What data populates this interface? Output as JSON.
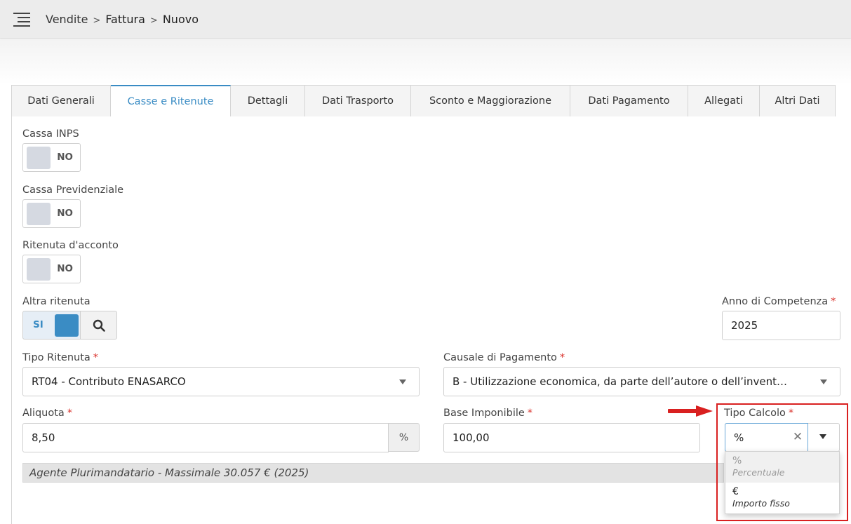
{
  "breadcrumb": [
    "Vendite",
    "Fattura",
    "Nuovo"
  ],
  "tabs": [
    "Dati Generali",
    "Casse e Ritenute",
    "Dettagli",
    "Dati Trasporto",
    "Sconto e Maggiorazione",
    "Dati Pagamento",
    "Allegati",
    "Altri Dati"
  ],
  "active_tab": "Casse e Ritenute",
  "colors": {
    "accent": "#3a8cc4",
    "required": "#d9302a",
    "highlight": "#d92020"
  },
  "form": {
    "cassa_inps": {
      "label": "Cassa INPS",
      "toggle": "NO"
    },
    "cassa_previdenziale": {
      "label": "Cassa Previdenziale",
      "toggle": "NO"
    },
    "ritenuta_acconto": {
      "label": "Ritenuta d'acconto",
      "toggle": "NO"
    },
    "altra_ritenuta": {
      "label": "Altra ritenuta",
      "toggle": "SI"
    },
    "anno_competenza": {
      "label": "Anno di Competenza",
      "required": "*",
      "value": "2025"
    },
    "tipo_ritenuta": {
      "label": "Tipo Ritenuta",
      "required": "*",
      "value": "RT04 - Contributo ENASARCO"
    },
    "causale_pagamento": {
      "label": "Causale di Pagamento",
      "required": "*",
      "value": "B - Utilizzazione economica, da parte dell’autore o dell’invent…"
    },
    "aliquota": {
      "label": "Aliquota",
      "required": "*",
      "value": "8,50",
      "addon": "%"
    },
    "base_imponibile": {
      "label": "Base Imponibile",
      "required": "*",
      "value": "100,00"
    },
    "tipo_calcolo": {
      "label": "Tipo Calcolo",
      "required": "*",
      "value": "%",
      "clear": "✕",
      "options": [
        {
          "symbol": "%",
          "description": "Percentuale"
        },
        {
          "symbol": "€",
          "description": "Importo fisso"
        }
      ]
    },
    "info": "Agente Plurimandatario - Massimale 30.057 € (2025)"
  }
}
